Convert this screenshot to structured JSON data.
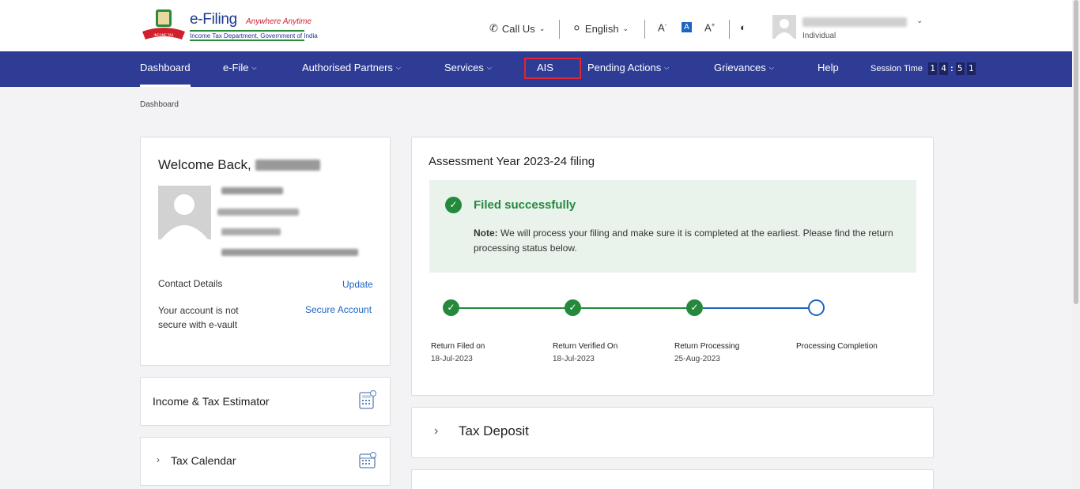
{
  "header": {
    "brand": "e-Filing",
    "tagline": "Anywhere Anytime",
    "department": "Income Tax Department, Government of India",
    "call_us": "Call Us",
    "language": "English",
    "font_decrease": "A",
    "font_normal": "A",
    "font_increase": "A",
    "user_name": "Masked user name",
    "user_type": "Individual"
  },
  "nav": {
    "items": [
      "Dashboard",
      "e-File",
      "Authorised Partners",
      "Services",
      "AIS",
      "Pending Actions",
      "Grievances",
      "Help"
    ],
    "session_label": "Session Time",
    "session_digits": [
      "1",
      "4",
      ":",
      "5",
      "1"
    ]
  },
  "breadcrumb": "Dashboard",
  "profile": {
    "welcome": "Welcome Back,",
    "contact_label": "Contact Details",
    "update_link": "Update",
    "evault_text": "Your account is not secure with e-vault",
    "secure_link": "Secure Account"
  },
  "widgets": {
    "estimator": "Income & Tax Estimator",
    "calendar": "Tax Calendar"
  },
  "filing": {
    "title": "Assessment Year 2023-24 filing",
    "status": "Filed successfully",
    "note_label": "Note:",
    "note_text": "We will process your filing and make sure it is completed at the earliest. Please find the return processing status below.",
    "steps": [
      {
        "label": "Return Filed on",
        "date": "18-Jul-2023"
      },
      {
        "label": "Return Verified On",
        "date": "18-Jul-2023"
      },
      {
        "label": "Return Processing",
        "date": "25-Aug-2023"
      },
      {
        "label": "Processing Completion",
        "date": ""
      }
    ]
  },
  "tax_deposit": "Tax Deposit",
  "colors": {
    "nav": "#2e3c96",
    "success": "#24893b",
    "link": "#1d65c1",
    "highlight": "#e0262e"
  }
}
